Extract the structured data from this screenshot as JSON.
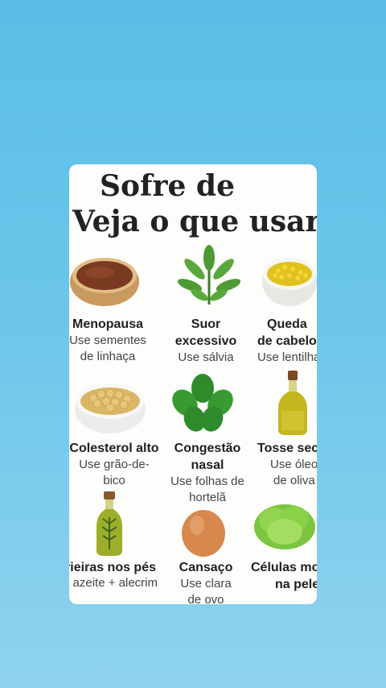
{
  "title": {
    "line1": "Sofre de",
    "line2": "Veja o que usar:"
  },
  "items": [
    {
      "name": "Menopausa",
      "tip": "Use sementes de linhaça",
      "tip_line1": "Use sementes",
      "tip_line2": "de linhaça"
    },
    {
      "name": "Suor excessivo",
      "name_line1": "Suor",
      "name_line2": "excessivo",
      "tip": "Use sálvia"
    },
    {
      "name": "Queda de cabelo",
      "name_line1": "Queda",
      "name_line2": "de cabelo",
      "tip": "Use lentilha"
    },
    {
      "name": "Colesterol alto",
      "tip": "Use grão-de-bico",
      "tip_line1": "Use grão-de-",
      "tip_line2": "bico"
    },
    {
      "name": "Congestão nasal",
      "name_line1": "Congestão",
      "name_line2": "nasal",
      "tip": "Use folhas de hortelã",
      "tip_line1": "Use folhas de",
      "tip_line2": "hortelã"
    },
    {
      "name": "Tosse seca",
      "tip": "Use óleo de oliva",
      "tip_line1": "Use óleo",
      "tip_line2": "de oliva"
    },
    {
      "name": "Frieiras nos pés",
      "tip": "Use azeite + alecrim"
    },
    {
      "name": "Cansaço",
      "tip": "Use clara de ovo",
      "tip_line1": "Use clara",
      "tip_line2": "de ovo"
    },
    {
      "name": "Células mortas na pele",
      "name_line1": "Células mortas",
      "name_line2": "na pele"
    }
  ]
}
